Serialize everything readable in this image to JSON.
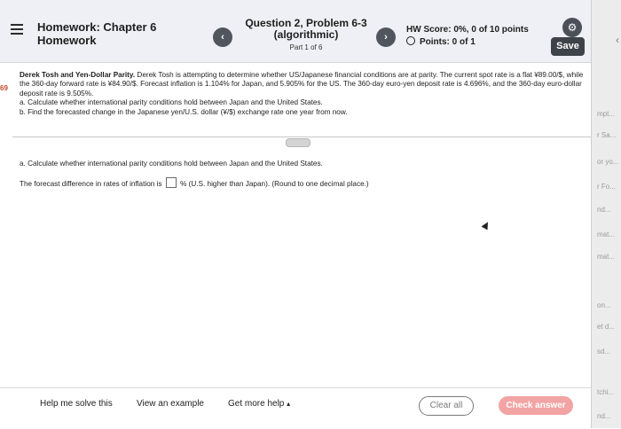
{
  "header": {
    "hw_title_line1": "Homework: Chapter 6",
    "hw_title_line2": "Homework",
    "prev_icon": "chevron-left-icon",
    "next_icon": "chevron-right-icon",
    "question_title_line1": "Question 2, Problem 6-3",
    "question_title_line2": "(algorithmic)",
    "question_part": "Part 1 of 6",
    "hw_score": "HW Score: 0%, 0 of 10 points",
    "points": "Points: 0 of 1",
    "save_label": "Save",
    "settings_icon": "gear-icon"
  },
  "side_fragments": [
    "mpt...",
    "r Sa...",
    "or yo...",
    "r Fo...",
    "nd...",
    "mat...",
    "mat...",
    "on...",
    "et d...",
    "sd...",
    "tchi...",
    "nd..."
  ],
  "left_marker": "69",
  "problem": {
    "title": "Derek Tosh and Yen-Dollar Parity.",
    "body": "Derek Tosh is attempting to determine whether US/Japanese financial conditions are at parity. The current spot rate is a flat ¥89.00/$, while the 360-day forward rate is ¥84.90/$. Forecast inflation is 1.104% for Japan, and 5.905% for the US. The 360-day euro-yen deposit rate is 4.696%, and the 360-day euro-dollar deposit rate is 9.505%.",
    "part_a": "a. Calculate whether international parity conditions hold between Japan and the United States.",
    "part_b": "b. Find the forecasted change in the Japanese yen/U.S. dollar (¥/$) exchange rate one year from now."
  },
  "work": {
    "question_a": "a. Calculate whether international parity conditions hold between Japan and the United States.",
    "answer_prefix": "The forecast difference in rates of inflation is",
    "answer_value": "",
    "answer_suffix": "% (U.S. higher than Japan).",
    "answer_hint": "(Round to one decimal place.)"
  },
  "footer": {
    "help_solve": "Help me solve this",
    "view_example": "View an example",
    "get_more_help": "Get more help",
    "get_more_help_caret": "▴",
    "clear_all": "Clear all",
    "check_answer": "Check answer"
  },
  "colors": {
    "header_bg": "#eef0f5",
    "button_dark": "#3e4249",
    "check_answer_bg": "#f2a3a3"
  }
}
